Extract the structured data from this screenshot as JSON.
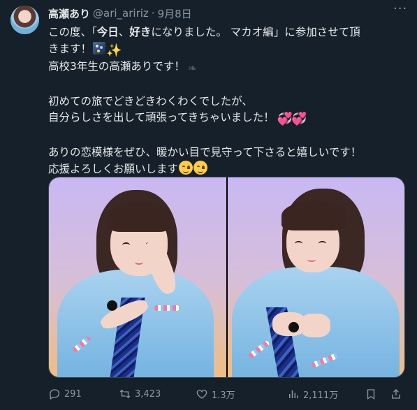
{
  "tweet": {
    "author": "高瀬あり",
    "handle": "@ari_aririz",
    "separator": "·",
    "date": "9月8日",
    "lines": {
      "l1_pre": "この度、「",
      "l1_b1": "今日",
      "l1_mid": "、",
      "l1_b2": "好き",
      "l1_post": "になりました。 マカオ編」に参加させて頂",
      "l2": "きます！",
      "l3": "高校3年生の高瀬ありです！",
      "l5": "初めての旅でどきどきわくわくでしたが、",
      "l6": "自分らしさを出して頑張ってきちゃいました！",
      "l8": "ありの恋模様をぜひ、暖かい目で見守って下さると嬉しいです！",
      "l9": "応援よろしくお願いします"
    },
    "emoji": {
      "city_night": "night-city-icon",
      "sparkles": "✨",
      "leaf": "leaf-icon",
      "hearts": "💞💞",
      "smile": "😋😋"
    },
    "actions": {
      "replies": "291",
      "retweets": "3,423",
      "likes": "1.3万",
      "views": "2,111万"
    }
  }
}
